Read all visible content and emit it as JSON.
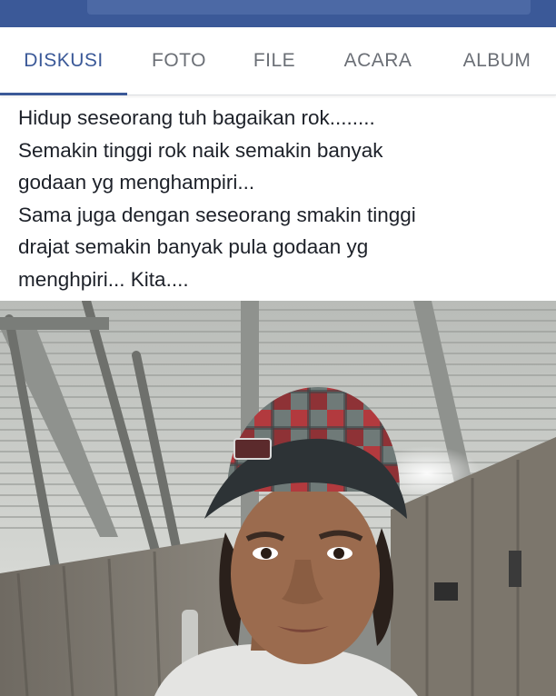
{
  "colors": {
    "brand": "#3b5998",
    "tab_inactive": "#6b6f76",
    "text": "#1d2129"
  },
  "tabs": [
    {
      "label": "DISKUSI",
      "active": true
    },
    {
      "label": "FOTO",
      "active": false
    },
    {
      "label": "FILE",
      "active": false
    },
    {
      "label": "ACARA",
      "active": false
    },
    {
      "label": "ALBUM",
      "active": false
    }
  ],
  "post": {
    "lines": [
      "Hidup seseorang tuh bagaikan rok........",
      "Semakin tinggi rok naik semakin banyak",
      "godaan yg menghampiri...",
      "Sama juga dengan seseorang smakin tinggi",
      "drajat semakin banyak pula godaan yg",
      "menghpiri... Kita...."
    ]
  }
}
